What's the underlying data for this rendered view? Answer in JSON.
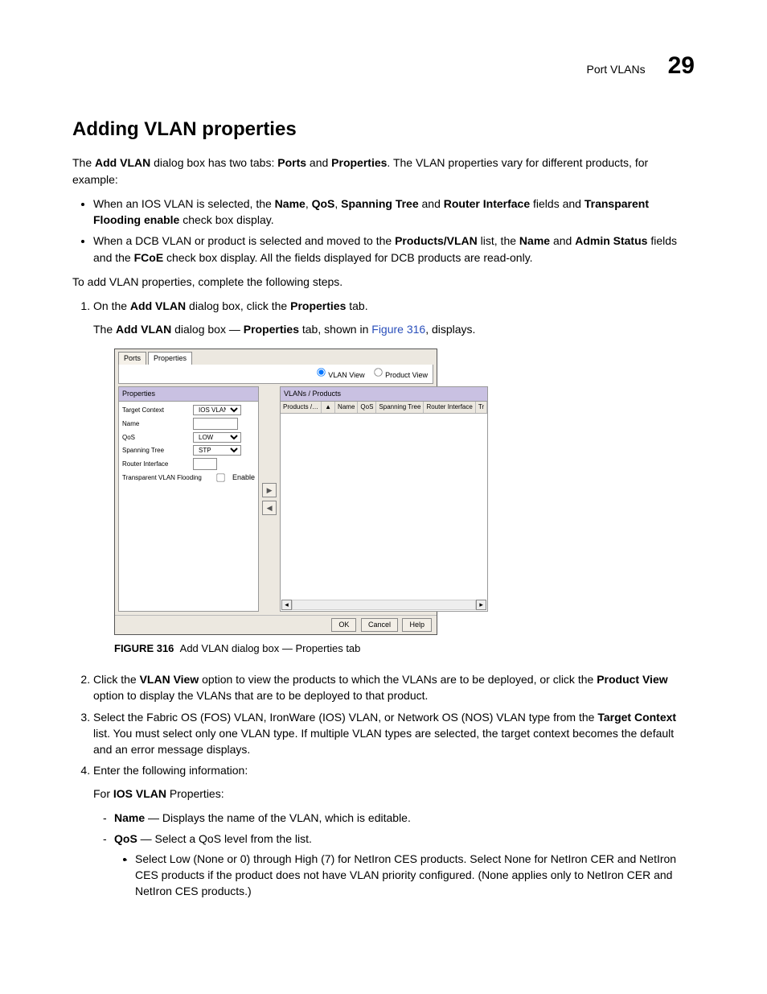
{
  "header": {
    "section": "Port VLANs",
    "page_number": "29"
  },
  "title": "Adding VLAN properties",
  "intro": "The Add VLAN dialog box has two tabs: Ports and Properties. The VLAN properties vary for different products, for example:",
  "bullets": [
    "When an IOS VLAN is selected, the Name, QoS, Spanning Tree and Router Interface fields and Transparent Flooding enable check box display.",
    "When a DCB VLAN or product is selected and moved to the Products/VLAN list, the Name and Admin Status fields and the FCoE check box display. All the fields displayed for DCB products are read-only."
  ],
  "lead": "To add VLAN properties, complete the following steps.",
  "step1": "On the Add VLAN dialog box, click the Properties tab.",
  "step1_sub": "The Add VLAN dialog box — Properties tab, shown in Figure 316, displays.",
  "figure_link": "Figure 316",
  "figcap_prefix": "FIGURE 316",
  "figcap_text": "Add VLAN dialog box — Properties tab",
  "step2": "Click the VLAN View option to view the products to which the VLANs are to be deployed, or click the Product View option to display the VLANs that are to be deployed to that product.",
  "step3": "Select the Fabric OS (FOS) VLAN, IronWare (IOS) VLAN, or Network OS (NOS) VLAN type from the Target Context list. You must select only one VLAN type. If multiple VLAN types are selected, the target context becomes the default and an error message displays.",
  "step4": "Enter the following information:",
  "step4_intro": "For IOS VLAN Properties:",
  "step4_items": [
    "Name — Displays the name of the VLAN, which is editable.",
    "QoS — Select a QoS level from the list."
  ],
  "step4_sub": "Select Low (None or 0) through High (7) for NetIron CES products. Select None for NetIron CER and NetIron CES products if the product does not have VLAN priority configured. (None applies only to NetIron CER and NetIron CES products.)",
  "dialog": {
    "tabs": [
      "Ports",
      "Properties"
    ],
    "view_options": {
      "vlan_view": "VLAN View",
      "product_view": "Product View"
    },
    "left_title": "Properties",
    "right_title": "VLANs / Products",
    "right_cols": [
      "Products /…",
      "Name",
      "QoS",
      "Spanning Tree",
      "Router Interface",
      "Tr"
    ],
    "fields": {
      "target_context": {
        "label": "Target Context",
        "value": "IOS VLAN"
      },
      "name": {
        "label": "Name",
        "value": ""
      },
      "qos": {
        "label": "QoS",
        "value": "LOW"
      },
      "spanning_tree": {
        "label": "Spanning Tree",
        "value": "STP"
      },
      "router_interface": {
        "label": "Router Interface",
        "value": ""
      },
      "trans_flood": {
        "label": "Transparent VLAN Flooding",
        "enable": "Enable"
      }
    },
    "buttons": {
      "ok": "OK",
      "cancel": "Cancel",
      "help": "Help"
    }
  }
}
